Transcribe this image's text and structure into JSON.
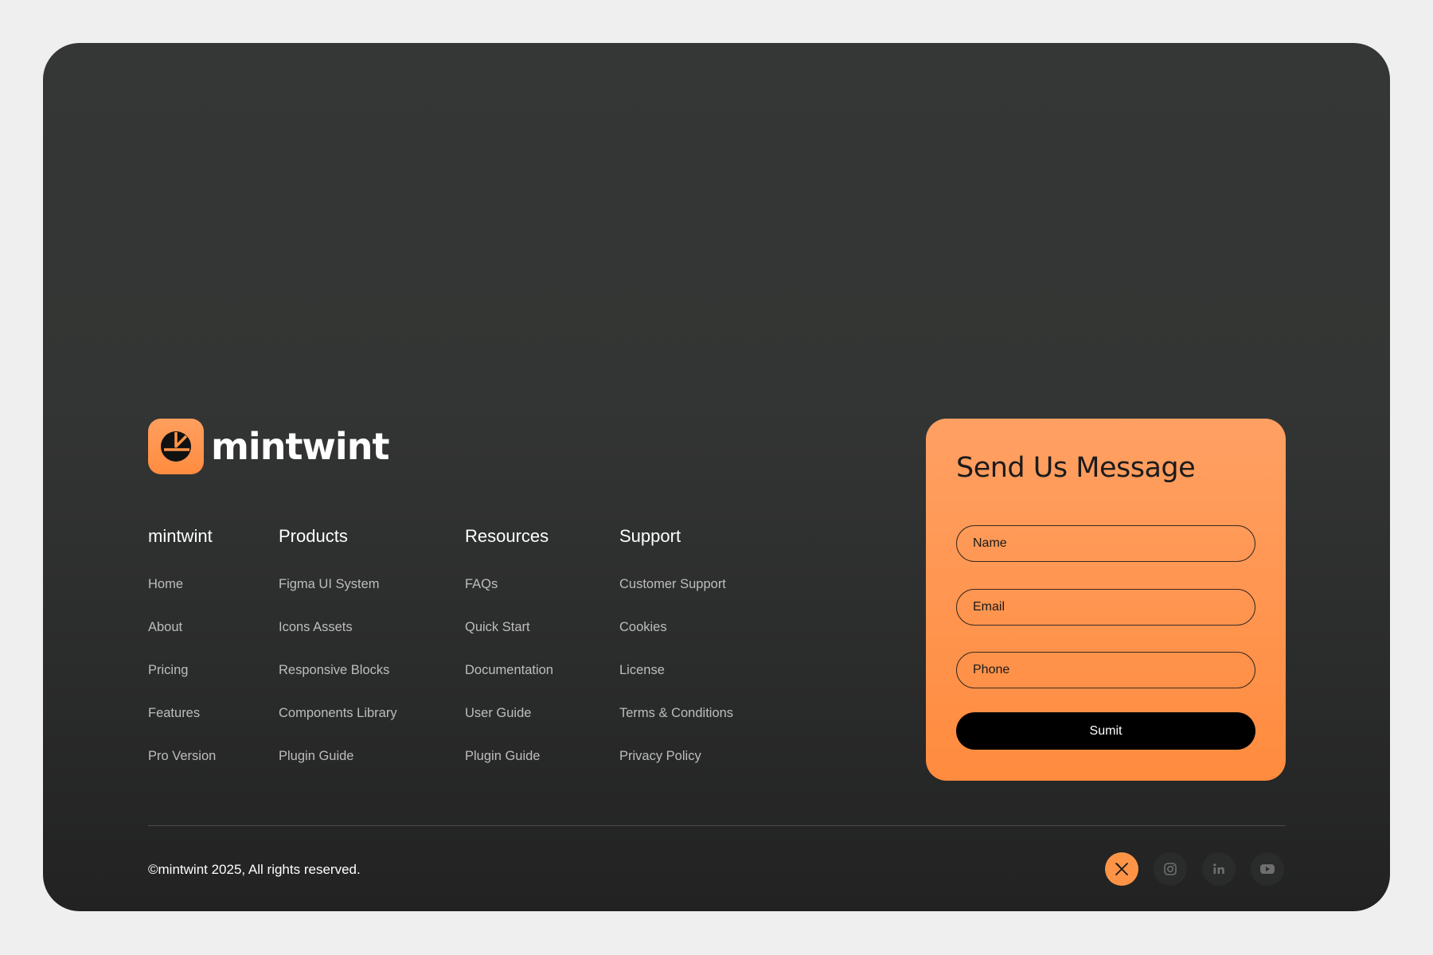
{
  "brand": {
    "name": "mintwint",
    "accent": "#ff9447"
  },
  "columns": [
    {
      "title": "mintwint",
      "items": [
        "Home",
        "About",
        "Pricing",
        "Features",
        "Pro Version"
      ]
    },
    {
      "title": "Products",
      "items": [
        "Figma UI System",
        "Icons Assets",
        "Responsive Blocks",
        "Components Library",
        "Plugin Guide"
      ]
    },
    {
      "title": "Resources",
      "items": [
        "FAQs",
        "Quick Start",
        "Documentation",
        "User Guide",
        "Plugin Guide"
      ]
    },
    {
      "title": "Support",
      "items": [
        "Customer Support",
        "Cookies",
        "License",
        "Terms & Conditions",
        "Privacy Policy"
      ]
    }
  ],
  "form": {
    "title": "Send Us Message",
    "name_placeholder": "Name",
    "email_placeholder": "Email",
    "phone_placeholder": "Phone",
    "submit_label": "Sumit"
  },
  "footer": {
    "copyright": "©mintwint 2025, All rights reserved.",
    "socials": [
      "x-icon",
      "instagram-icon",
      "linkedin-icon",
      "youtube-icon"
    ]
  }
}
